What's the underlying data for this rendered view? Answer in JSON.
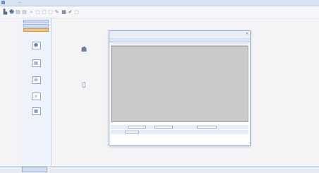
{
  "window": {
    "title": "—"
  },
  "toolbar": {
    "buttons": [
      {
        "icon": "print-icon",
        "glyph": "▙",
        "color": "#5a6a88"
      },
      {
        "icon": "users-icon",
        "glyph": "☻",
        "color": "#3c6ab0"
      },
      {
        "icon": "doc-icon",
        "glyph": "▤",
        "color": "#8a9bb8"
      },
      {
        "icon": "doc-icon",
        "glyph": "▤",
        "color": "#8a9bb8"
      },
      {
        "icon": "search-icon",
        "glyph": "⌕",
        "color": "#7a8aa8"
      },
      {
        "icon": "doc-icon",
        "glyph": "▢",
        "color": "#a0aec4"
      },
      {
        "icon": "doc-icon",
        "glyph": "▢",
        "color": "#a0aec4"
      },
      {
        "icon": "doc-icon",
        "glyph": "▢",
        "color": "#a0aec4"
      },
      {
        "icon": "edit-icon",
        "glyph": "✎",
        "color": "#6a7a98"
      },
      {
        "icon": "grid-icon",
        "glyph": "▦",
        "color": "#4a5a78"
      },
      {
        "icon": "check-icon",
        "glyph": "✔",
        "color": "#3aa04a"
      },
      {
        "icon": "doc-icon",
        "glyph": "▢",
        "color": "#a0aec4"
      }
    ]
  },
  "sidebar": {
    "headers": [
      "",
      "",
      ""
    ],
    "items": [
      {
        "icon": "users-icon",
        "glyph": "☻",
        "label": ""
      },
      {
        "icon": "doc-icon",
        "glyph": "▤",
        "label": ""
      },
      {
        "icon": "list-icon",
        "glyph": "☰",
        "label": ""
      },
      {
        "icon": "search-icon",
        "glyph": "⌕",
        "label": ""
      },
      {
        "icon": "grid-icon",
        "glyph": "▦",
        "label": ""
      }
    ]
  },
  "desktop": {
    "icons": [
      {
        "icon": "person-icon",
        "glyph": "☗",
        "label": ""
      },
      {
        "icon": "doc-icon",
        "glyph": "▯",
        "label": ""
      }
    ]
  },
  "dialog": {
    "title": "",
    "close": "✕",
    "tabs": [
      "",
      "",
      "",
      "",
      ""
    ],
    "columns": [
      "",
      "",
      "",
      "",
      "",
      ""
    ],
    "info": "",
    "row1": {
      "labels": [
        "",
        "",
        ""
      ],
      "values": [
        "",
        "",
        ""
      ]
    },
    "row2": {
      "labels": [
        ""
      ],
      "values": [
        ""
      ]
    },
    "buttons": [
      "",
      "",
      ""
    ]
  },
  "statusbar": {
    "active": "",
    "segments": [
      "",
      "",
      ""
    ]
  }
}
